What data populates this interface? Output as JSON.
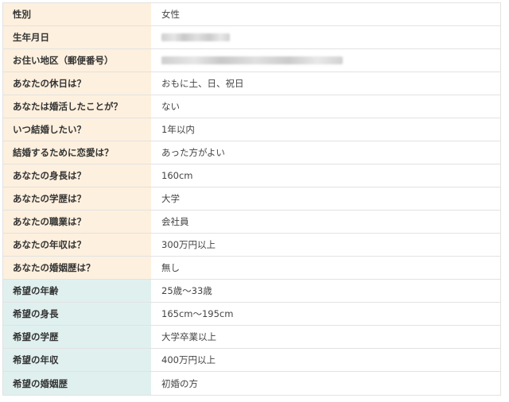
{
  "profile": [
    {
      "label": "性別",
      "value": "女性"
    },
    {
      "label": "生年月日",
      "value": "",
      "redacted": true
    },
    {
      "label": "お住い地区（郵便番号）",
      "value": "",
      "redacted": true
    },
    {
      "label": "あなたの休日は？",
      "value": "おもに土、日、祝日"
    },
    {
      "label": "あなたは婚活したことが？",
      "value": "ない"
    },
    {
      "label": "いつ結婚したい？",
      "value": "1年以内"
    },
    {
      "label": "結婚するために恋愛は？",
      "value": "あった方がよい"
    },
    {
      "label": "あなたの身長は？",
      "value": "160cm"
    },
    {
      "label": "あなたの学歴は？",
      "value": "大学"
    },
    {
      "label": "あなたの職業は？",
      "value": "会社員"
    },
    {
      "label": "あなたの年収は？",
      "value": "300万円以上"
    },
    {
      "label": "あなたの婚姻歴は？",
      "value": "無し"
    }
  ],
  "preferences": [
    {
      "label": "希望の年齢",
      "value": "25歳〜33歳"
    },
    {
      "label": "希望の身長",
      "value": "165cm〜195cm"
    },
    {
      "label": "希望の学歴",
      "value": "大学卒業以上"
    },
    {
      "label": "希望の年収",
      "value": "400万円以上"
    },
    {
      "label": "希望の婚姻歴",
      "value": "初婚の方"
    }
  ],
  "colors": {
    "profile_label_bg": "#fdf0de",
    "preference_label_bg": "#dff0ef",
    "border": "#e2e2e2",
    "text": "#333333"
  }
}
